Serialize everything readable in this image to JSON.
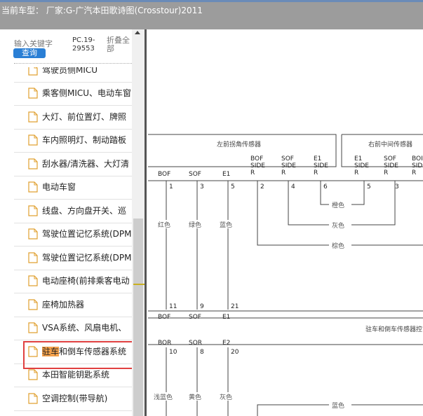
{
  "header": {
    "title": "当前车型：  厂家:G-广汽本田歌诗图(Crosstour)2011"
  },
  "search": {
    "keyword_placeholder": "输入关键字",
    "query_button": "查询",
    "pc_code": "PC.19-29553",
    "collapse_all": "折叠全部"
  },
  "tree": {
    "items": [
      {
        "label": "驾驶员侧MICU"
      },
      {
        "label": "乘客侧MICU、电动车窗"
      },
      {
        "label": "大灯、前位置灯、牌照"
      },
      {
        "label": "车内照明灯、制动踏板"
      },
      {
        "label": "刮水器/清洗器、大灯清"
      },
      {
        "label": "电动车窗"
      },
      {
        "label": "线盘、方向盘开关、巡"
      },
      {
        "label": "驾驶位置记忆系统(DPM"
      },
      {
        "label": "驾驶位置记忆系统(DPM"
      },
      {
        "label": "电动座椅(前排乘客电动"
      },
      {
        "label": "座椅加热器"
      },
      {
        "label": "VSA系统、风扇电机、"
      },
      {
        "label_highlight": "驻车",
        "label_rest": "和倒车传感器系统"
      },
      {
        "label": "本田智能钥匙系统"
      },
      {
        "label": "空调控制(带导航)"
      }
    ]
  },
  "diagram": {
    "box_left_title": "左前拐角传感器",
    "box_right_title": "右前中间传感器",
    "top_labels": [
      "BOF",
      "SOF",
      "E1"
    ],
    "side_labels": [
      {
        "l1": "BOF",
        "l2": "SIDE",
        "l3": "R"
      },
      {
        "l1": "SOF",
        "l2": "SIDE",
        "l3": "R"
      },
      {
        "l1": "E1",
        "l2": "SIDE",
        "l3": "R"
      }
    ],
    "right_labels": [
      {
        "l1": "E1",
        "l2": "SIDE",
        "l3": "R"
      },
      {
        "l1": "SOF",
        "l2": "SIDE",
        "l3": "R"
      },
      {
        "l1": "BOI",
        "l2": "SIDE",
        "l3": "R"
      }
    ],
    "pins_top": [
      "1",
      "3",
      "5",
      "2",
      "4",
      "6",
      "5",
      "3"
    ],
    "wire_colors_left": [
      "红色",
      "绿色",
      "蓝色"
    ],
    "wire_colors_right": [
      "橙色",
      "灰色",
      "棕色"
    ],
    "pins_mid": [
      "11",
      "9",
      "21"
    ],
    "mid_labels": [
      "BOF",
      "SOF",
      "E1"
    ],
    "module_title": "驻车和倒车传感器控",
    "bottom_labels": [
      "BOR",
      "SOR",
      "E2"
    ],
    "pins_bottom": [
      "10",
      "8",
      "20"
    ],
    "wire_colors_bottom": [
      "浅蓝色",
      "黄色",
      "灰色"
    ],
    "wire_color_blue": "蓝色"
  }
}
